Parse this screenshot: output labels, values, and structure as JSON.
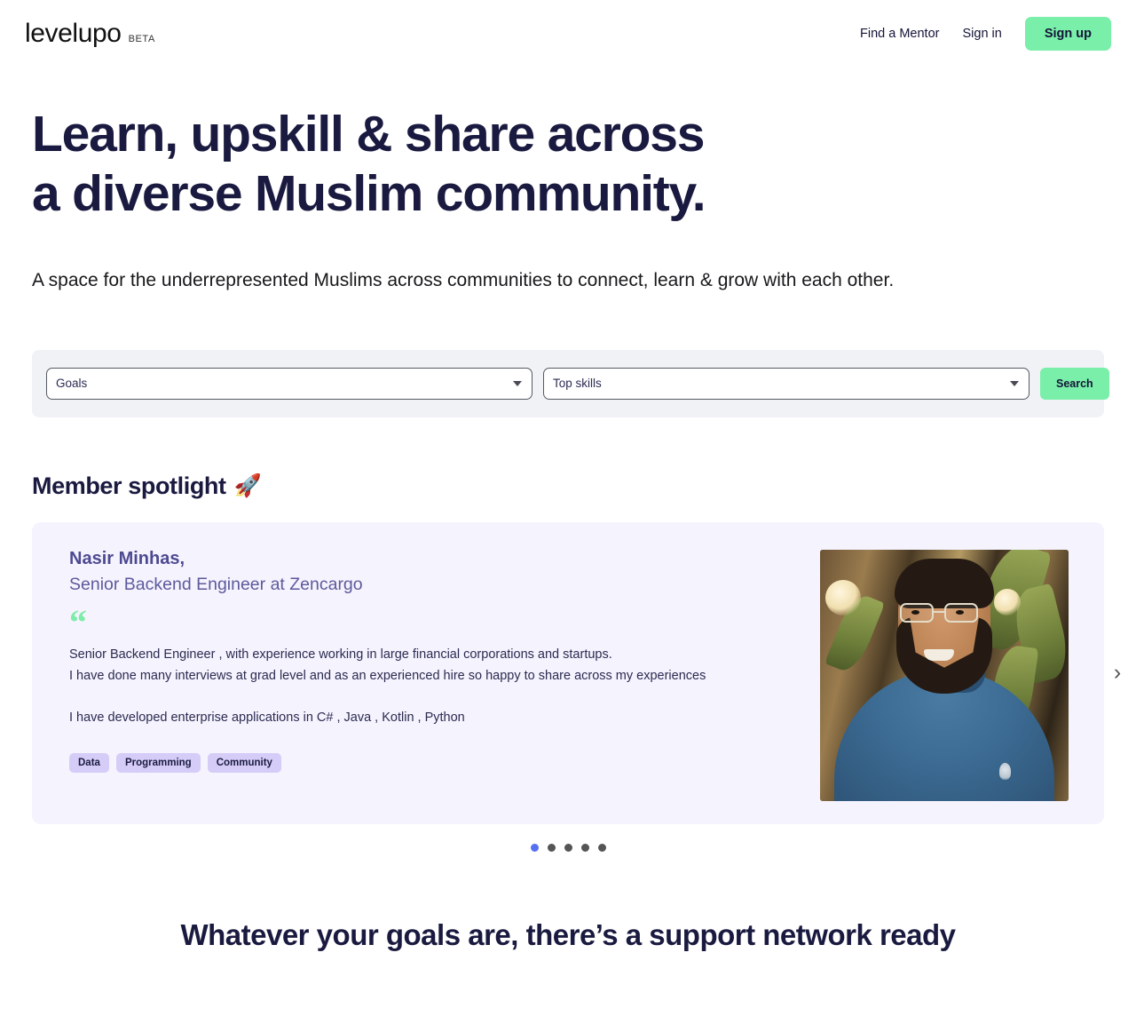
{
  "header": {
    "brand_word": "levelupo",
    "brand_beta": "BETA",
    "nav": [
      {
        "label": "Find a Mentor",
        "name": "nav-find-a-mentor"
      },
      {
        "label": "Sign in",
        "name": "nav-sign-in"
      }
    ],
    "signup_label": "Sign up",
    "accent_green": "#79efa9"
  },
  "hero": {
    "title_line1": "Learn, upskill & share across",
    "title_line2": "a diverse Muslim community.",
    "subtitle": "A space for the underrepresented Muslims across communities to connect, learn & grow with each other.",
    "title_color": "#1a1a40"
  },
  "search": {
    "goals_value": "Goals",
    "skills_value": "Top skills",
    "button_label": "Search",
    "panel_bg": "#f0f2f5"
  },
  "spotlight": {
    "heading": "Member spotlight",
    "rocket_icon": "🚀",
    "card": {
      "name": "Nasir Minhas,",
      "role": "Senior Backend Engineer at Zencargo",
      "quote_glyph": "“",
      "bio": "Senior Backend Engineer , with experience working in large financial corporations and startups.\nI have done many interviews at grad level and as an experienced hire so happy to share across my experiences\n\nI have developed enterprise applications in C# , Java , Kotlin , Python",
      "tags": [
        "Data",
        "Programming",
        "Community"
      ],
      "card_bg": "#f5f3fe",
      "tag_bg": "#d5cdf8",
      "name_color": "#4d4a91"
    },
    "next_arrow": "›",
    "dots": {
      "count": 5,
      "active_index": 0,
      "active_color": "#5570f0",
      "inactive_color": "#555555"
    }
  },
  "bottom": {
    "heading": "Whatever your goals are, there’s a support network ready"
  }
}
